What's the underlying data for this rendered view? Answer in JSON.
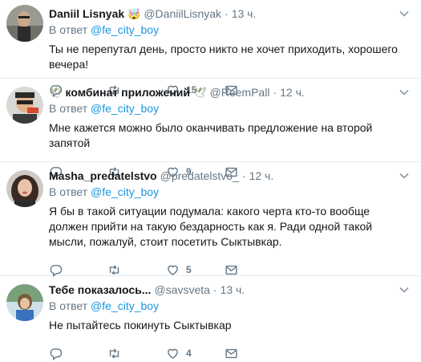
{
  "tweets": [
    {
      "name": "Daniil Lisnyak",
      "emoji": "🤯",
      "handle": "@DaniilLisnyak",
      "time": "13 ч.",
      "reply_prefix": "В ответ",
      "reply_to": "@fe_city_boy",
      "text": "Ты не перепутал день, просто никто не хочет приходить, хорошего вечера!",
      "likes": "15"
    },
    {
      "name": "комбинат приложений",
      "emoji_left": "🕊",
      "emoji_right": "🕊",
      "handle": "@ReemPall",
      "time": "12 ч.",
      "reply_prefix": "В ответ",
      "reply_to": "@fe_city_boy",
      "text": "Мне кажется можно было оканчивать предложение на второй запятой",
      "likes": "9"
    },
    {
      "name": "Masha_predatelstvo",
      "handle": "@predatelstvo_",
      "time": "12 ч.",
      "reply_prefix": "В ответ",
      "reply_to": "@fe_city_boy",
      "text": "Я бы в такой ситуации подумала: какого черта кто-то вообще должен прийти на такую бездарность как я. Ради одной такой мысли, пожалуй, стоит посетить Сыктывкар.",
      "likes": "5"
    },
    {
      "name": "Тебе показалось...",
      "handle": "@savsveta",
      "time": "13 ч.",
      "reply_prefix": "В ответ",
      "reply_to": "@fe_city_boy",
      "text": "Не пытайтесь покинуть Сыктывкар",
      "likes": "4"
    }
  ],
  "separator": "·",
  "icons": {
    "reply": "reply-icon",
    "retweet": "retweet-icon",
    "like": "heart-icon",
    "dm": "envelope-icon",
    "menu": "chevron-down-icon"
  },
  "colors": {
    "link": "#1b95e0",
    "secondary": "#657786",
    "text": "#14171a",
    "border": "#e6ecf0"
  }
}
